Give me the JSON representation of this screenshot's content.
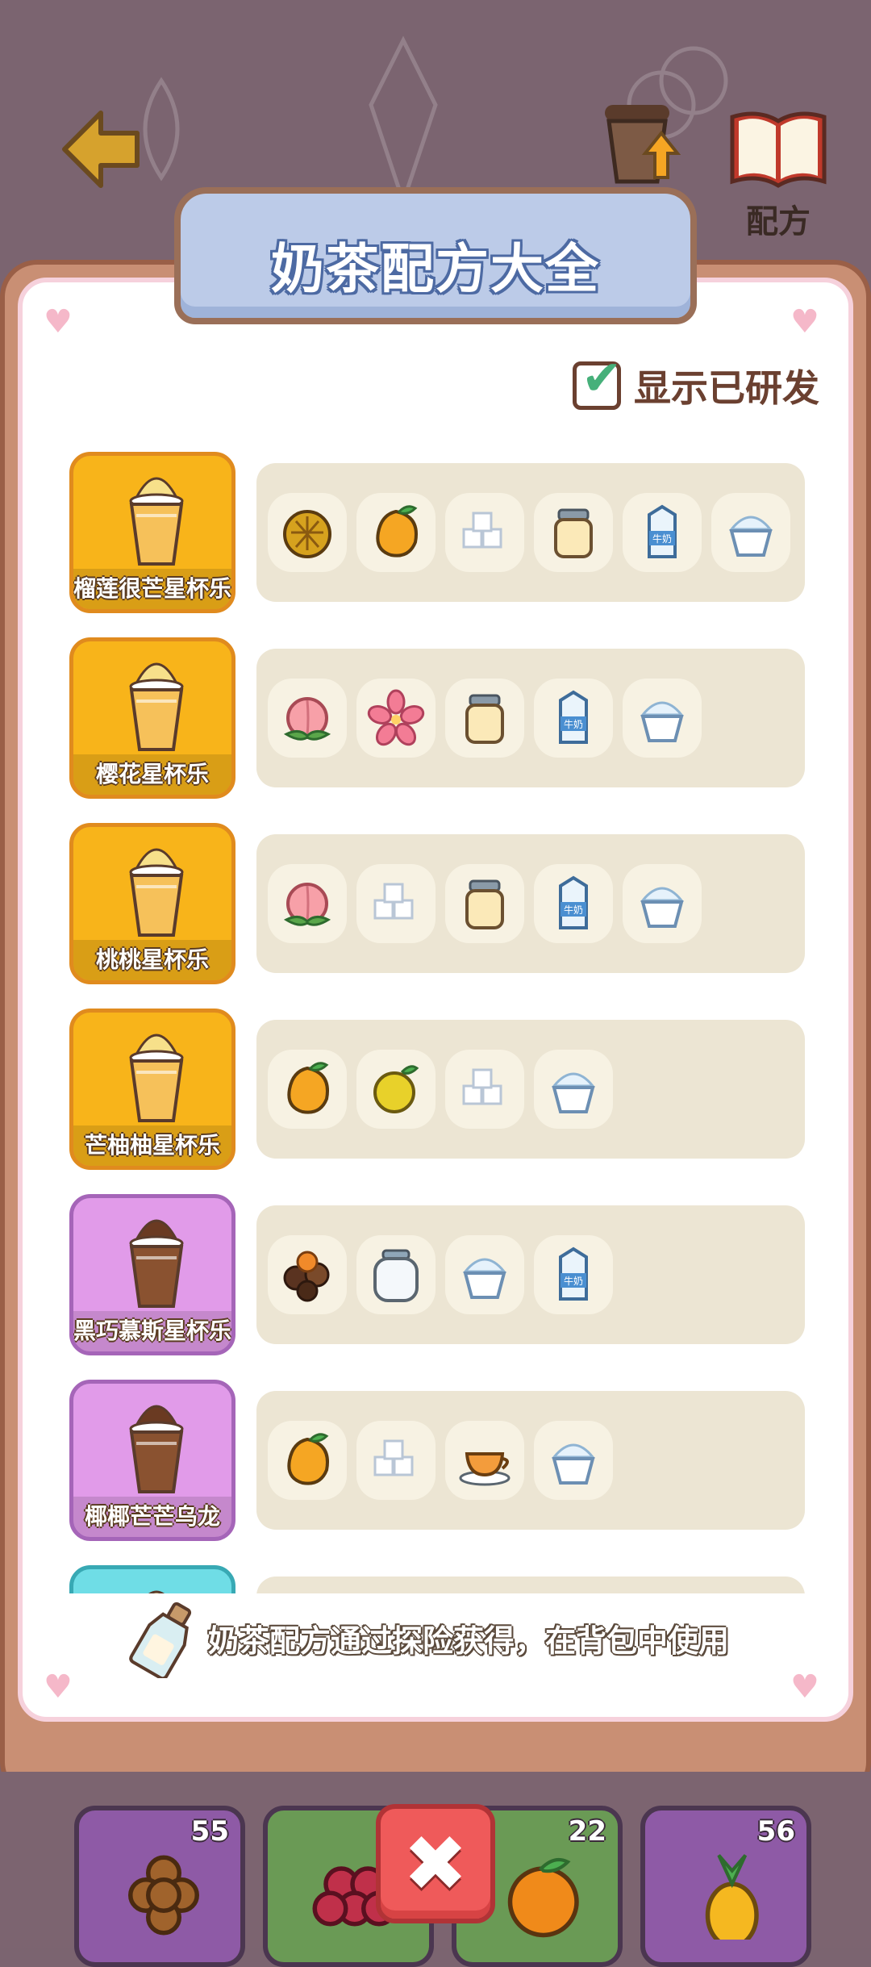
{
  "header": {
    "upgrade_label": "升级",
    "recipe_label": "配方"
  },
  "panel": {
    "title": "奶茶配方大全",
    "show_developed_label": "显示已研发",
    "show_developed_checked": true,
    "tip": "奶茶配方通过探险获得，在背包中使用"
  },
  "recipes": [
    {
      "name": "榴莲很芒星杯乐",
      "tier": "orange",
      "ingredients": [
        "durian-icon",
        "mango-icon",
        "sugar-cubes-icon",
        "condensed-milk-jar-icon",
        "milk-carton-icon",
        "ice-cream-icon"
      ]
    },
    {
      "name": "樱花星杯乐",
      "tier": "orange",
      "ingredients": [
        "peach-icon",
        "sakura-icon",
        "condensed-milk-jar-icon",
        "milk-carton-icon",
        "ice-cream-icon"
      ]
    },
    {
      "name": "桃桃星杯乐",
      "tier": "orange",
      "ingredients": [
        "peach-icon",
        "sugar-cubes-icon",
        "condensed-milk-jar-icon",
        "milk-carton-icon",
        "ice-cream-icon"
      ]
    },
    {
      "name": "芒柚柚星杯乐",
      "tier": "orange",
      "ingredients": [
        "mango-icon",
        "pomelo-icon",
        "sugar-cubes-icon",
        "ice-cream-icon"
      ]
    },
    {
      "name": "黑巧慕斯星杯乐",
      "tier": "purple",
      "ingredients": [
        "chocolates-icon",
        "glass-jar-icon",
        "ice-cream-icon",
        "milk-carton-icon"
      ]
    },
    {
      "name": "椰椰芒芒乌龙",
      "tier": "purple",
      "ingredients": [
        "mango-icon",
        "sugar-cubes-icon",
        "tea-cup-icon",
        "ice-cream-icon"
      ]
    }
  ],
  "inventory": [
    {
      "item": "tapioca-pearls-icon",
      "count": "55",
      "color": "#8e5aa6"
    },
    {
      "item": "grapes-icon",
      "count": "",
      "color": "#6a9a55"
    },
    {
      "item": "orange-icon",
      "count": "22",
      "color": "#6a9a55"
    },
    {
      "item": "pineapple-icon",
      "count": "56",
      "color": "#8e5aa6"
    }
  ],
  "colors": {
    "accent_title": "#bccbe8",
    "close": "#ef5a5a",
    "orange_tier": "#f8b41a",
    "purple_tier": "#e19be9"
  }
}
